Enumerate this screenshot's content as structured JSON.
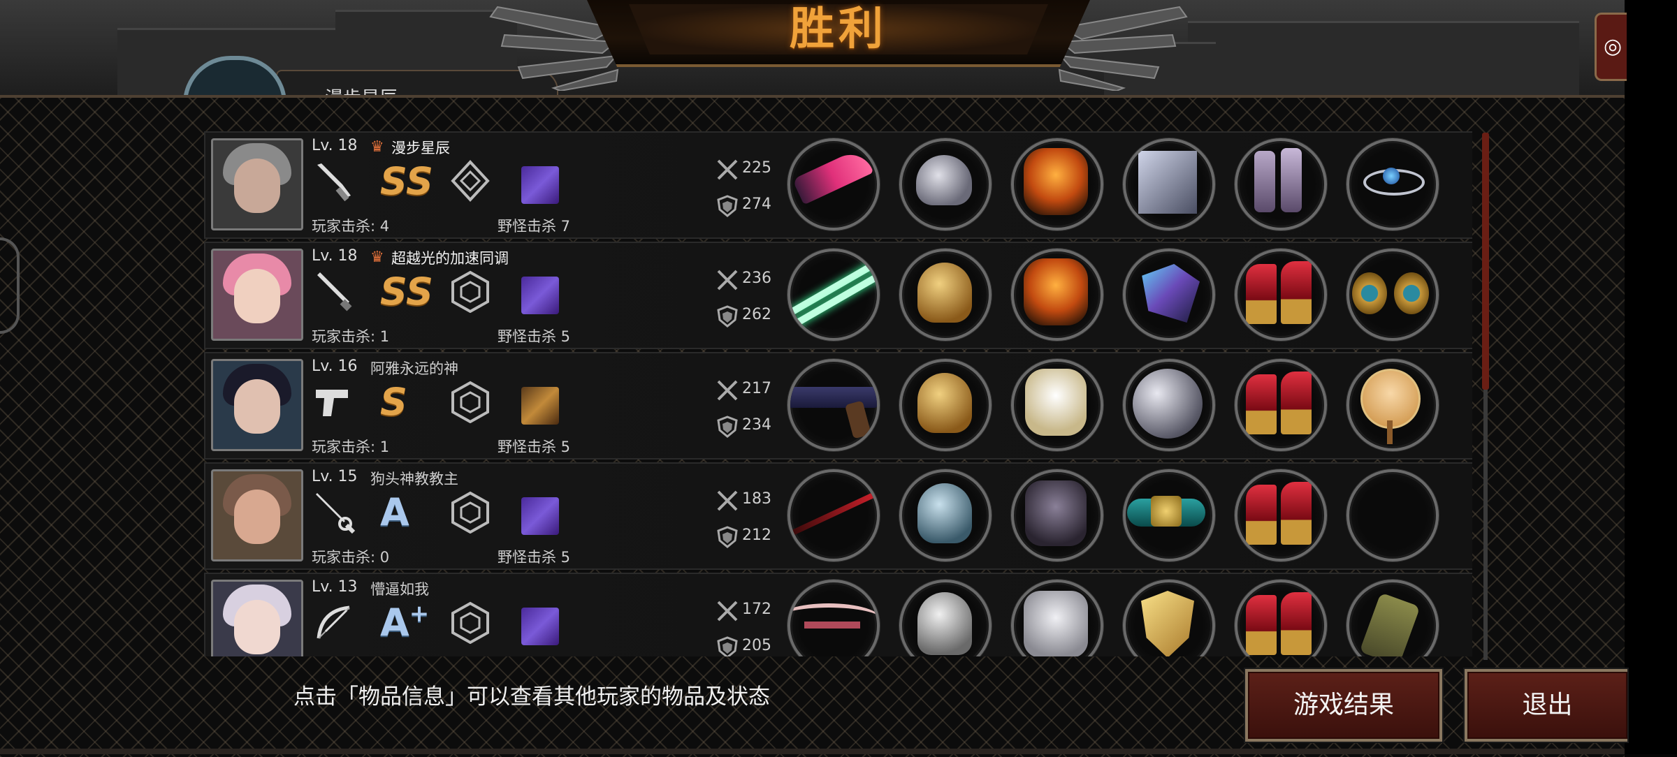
{
  "banner": {
    "title": "胜利"
  },
  "top_partial_name": "漫步星辰",
  "players": [
    {
      "level": "Lv. 18",
      "name": "漫步星辰",
      "crown": true,
      "rank": "SS",
      "rank_color": "gold",
      "weapon": "knife-icon",
      "player_kills": "玩家击杀: 4",
      "monster_kills": "野怪击杀 7",
      "attack": "225",
      "defense": "274",
      "portrait": {
        "hair": "#8a8a8a",
        "skin": "#c8a898",
        "bg": "#3a3a3a"
      },
      "items": [
        "crimson-blade-item",
        "robot-helmet-item",
        "flaming-armor-item",
        "spiked-gauntlet-item",
        "purple-boots-item",
        "blue-gem-ring-item"
      ]
    },
    {
      "level": "Lv. 18",
      "name": "超越光的加速同调",
      "crown": true,
      "rank": "SS",
      "rank_color": "gold",
      "weapon": "baton-icon",
      "player_kills": "玩家击杀: 1",
      "monster_kills": "野怪击杀 5",
      "attack": "236",
      "defense": "262",
      "portrait": {
        "hair": "#e88aa8",
        "skin": "#f0d0c0",
        "bg": "#6a4a5a"
      },
      "items": [
        "green-lightsaber-item",
        "gold-helmet-item",
        "flaming-armor-item",
        "lightning-gauntlet-item",
        "red-heels-item",
        "gold-earrings-item"
      ]
    },
    {
      "level": "Lv. 16",
      "name": "阿雅永远的神",
      "crown": false,
      "rank": "S",
      "rank_color": "gold",
      "weapon": "pistol-icon",
      "player_kills": "玩家击杀: 1",
      "monster_kills": "野怪击杀 5",
      "attack": "217",
      "defense": "234",
      "portrait": {
        "hair": "#1a1a2a",
        "skin": "#e0c0b0",
        "bg": "#2a3a4a"
      },
      "items": [
        "revolver-item",
        "gold-helmet-item",
        "white-armor-item",
        "silver-disc-item",
        "red-heels-item",
        "portrait-fan-item"
      ]
    },
    {
      "level": "Lv. 15",
      "name": "狗头神教教主",
      "crown": false,
      "rank": "A",
      "rank_color": "blue",
      "weapon": "rapier-icon",
      "player_kills": "玩家击杀: 0",
      "monster_kills": "野怪击杀 5",
      "attack": "183",
      "defense": "212",
      "portrait": {
        "hair": "#7a5a4a",
        "skin": "#d8a890",
        "bg": "#5a4a3a"
      },
      "items": [
        "red-staff-item",
        "steel-helmet-item",
        "dark-armor-item",
        "gold-bracelet-item",
        "red-heels-item",
        "empty-slot"
      ]
    },
    {
      "level": "Lv. 13",
      "name": "懵逼如我",
      "crown": false,
      "rank": "A+",
      "rank_color": "blue",
      "weapon": "bow-icon",
      "player_kills": "",
      "monster_kills": "",
      "attack": "172",
      "defense": "205",
      "portrait": {
        "hair": "#d8d0e0",
        "skin": "#f0d8d0",
        "bg": "#3a3a4a"
      },
      "items": [
        "crossbow-item",
        "knight-helmet-item",
        "plate-armor-item",
        "gold-shield-item",
        "red-heels-item",
        "quiver-item"
      ]
    }
  ],
  "hint": "点击「物品信息」可以查看其他玩家的物品及状态",
  "buttons": {
    "result": "游戏结果",
    "exit": "退出"
  },
  "colors": {
    "accent": "#f0a23a",
    "button": "#5c2018",
    "scroll_thumb": "#6a1e14"
  }
}
